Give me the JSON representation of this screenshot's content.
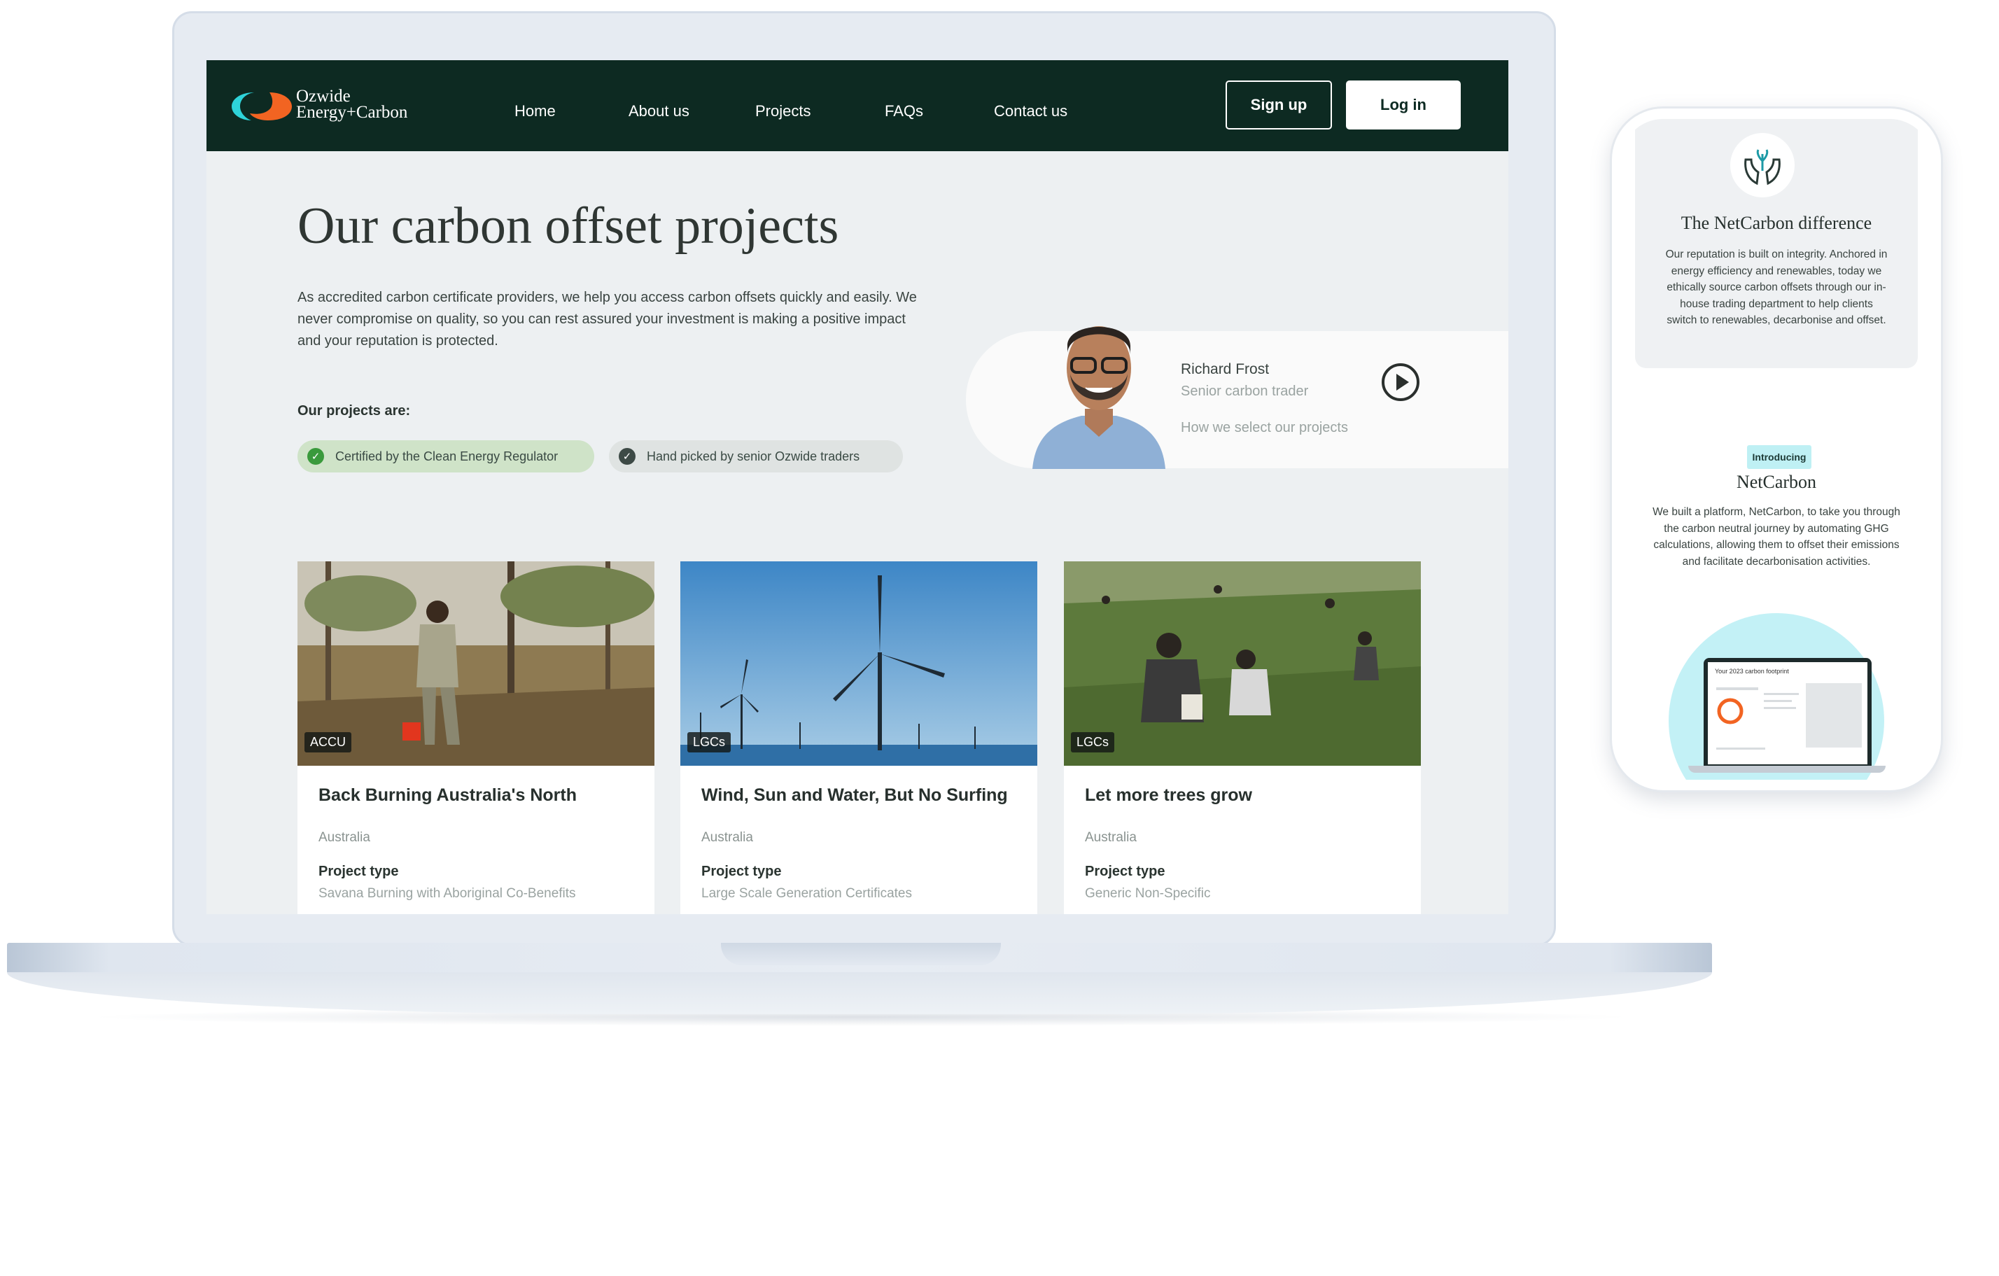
{
  "nav": {
    "logo_line1": "Ozwide",
    "logo_line2": "Energy+Carbon",
    "links": [
      "Home",
      "About us",
      "Projects",
      "FAQs",
      "Contact us"
    ],
    "signup": "Sign up",
    "login": "Log in"
  },
  "hero": {
    "title": "Our carbon offset projects",
    "description": "As accredited carbon certificate providers, we help you access carbon offsets quickly and easily. We never compromise on quality, so you can rest assured your investment is making a positive impact and your reputation is protected.",
    "projects_are": "Our projects are:",
    "pills": [
      "Certified by the Clean Energy Regulator",
      "Hand picked by senior Ozwide traders"
    ]
  },
  "video": {
    "name": "Richard Frost",
    "role": "Senior carbon trader",
    "link": "How we select our projects"
  },
  "cards": [
    {
      "badge": "ACCU",
      "title": "Back Burning Australia's North",
      "country": "Australia",
      "type_label": "Project type",
      "type_value": "Savana Burning with Aboriginal Co-Benefits"
    },
    {
      "badge": "LGCs",
      "title": "Wind, Sun and Water, But No Surfing",
      "country": "Australia",
      "type_label": "Project type",
      "type_value": "Large Scale Generation Certificates"
    },
    {
      "badge": "LGCs",
      "title": "Let more trees grow",
      "country": "Australia",
      "type_label": "Project type",
      "type_value": "Generic Non-Specific"
    }
  ],
  "phone": {
    "heading": "The NetCarbon difference",
    "paragraph": "Our reputation is built on integrity. Anchored in energy efficiency and renewables, today we ethically source carbon offsets through our in-house trading department to help clients switch to renewables, decarbonise and offset.",
    "badge": "Introducing",
    "heading2": "NetCarbon",
    "paragraph2": "We built a platform, NetCarbon, to take you through the carbon neutral journey by automating GHG calculations, allowing them to offset their emissions and facilitate decarbonisation activities.",
    "mini_screen_title": "Your 2023 carbon footprint"
  },
  "colors": {
    "nav_bg": "#0d2a22",
    "accent_teal": "#2ed3d9",
    "accent_orange": "#f26422",
    "pill_green": "#cfe3c8",
    "badge_cyan": "#bff0f4"
  },
  "icons": [
    "logo-icon",
    "check-icon",
    "play-icon",
    "hands-icon"
  ]
}
